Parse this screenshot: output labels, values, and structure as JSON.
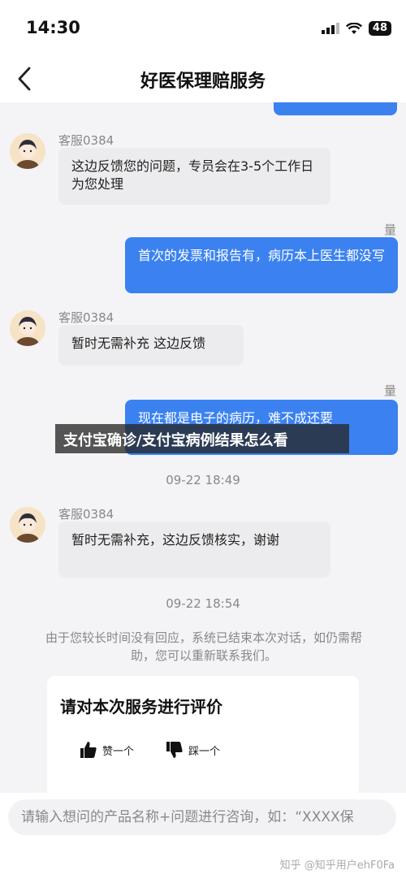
{
  "status_bar": {
    "time": "14:30",
    "battery": "48"
  },
  "nav": {
    "title": "好医保理赔服务"
  },
  "messages": {
    "agent_name": "客服0384",
    "m1": "这边反馈您的问题，专员会在3-5个工作日为您处理",
    "corner_1": "量",
    "m2": "首次的发票和报告有，病历本上医生都没写",
    "m3": "暂时无需补充 这边反馈",
    "corner_2": "量",
    "m4": "现在都是电子的病历，难不成还要",
    "ts1": "09-22 18:49",
    "m5": "暂时无需补充，这边反馈核实，谢谢",
    "ts2": "09-22 18:54",
    "notice": "由于您较长时间没有回应，系统已结束本次对话，如仍需帮助，您可以重新联系我们。"
  },
  "rating": {
    "title": "请对本次服务进行评价",
    "like_label": "赞一个",
    "dislike_label": "踩一个"
  },
  "overlay": {
    "banner": "支付宝确诊/支付宝病例结果怎么看"
  },
  "input": {
    "placeholder": "请输入想问的产品名称+问题进行咨询，如：“XXXX保"
  },
  "watermark": "知乎 @知乎用户ehF0Fa",
  "colors": {
    "accent": "#3b82f0",
    "chat_bg": "#f4f4f6",
    "agent_bubble": "#ececee"
  }
}
